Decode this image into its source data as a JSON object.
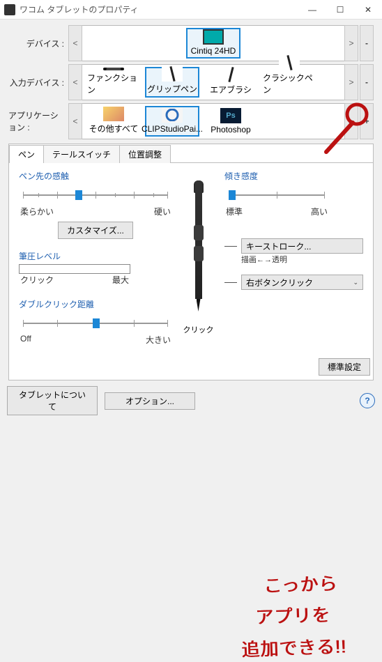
{
  "window": {
    "title": "ワコム タブレットのプロパティ"
  },
  "rows": {
    "device": {
      "label": "デバイス :",
      "items": [
        "Cintiq 24HD"
      ],
      "selected": 0
    },
    "input": {
      "label": "入力デバイス :",
      "items": [
        "ファンクション",
        "グリップペン",
        "エアブラシ",
        "クラシックペン"
      ],
      "selected": 1
    },
    "app": {
      "label": "アプリケーション :",
      "items": [
        "その他すべて",
        "CLIPStudioPai...",
        "Photoshop"
      ],
      "selected": 1,
      "plus": "+"
    }
  },
  "tabs": {
    "items": [
      "ペン",
      "テールスイッチ",
      "位置調整"
    ],
    "active": 0
  },
  "pen": {
    "tipfeel": {
      "title": "ペン先の感触",
      "left": "柔らかい",
      "right": "硬い",
      "customize": "カスタマイズ..."
    },
    "pressure": {
      "title": "筆圧レベル",
      "left": "クリック",
      "right": "最大"
    },
    "dblclick": {
      "title": "ダブルクリック距離",
      "left": "Off",
      "right": "大きい"
    },
    "tiplabel": "クリック",
    "tilt": {
      "title": "傾き感度",
      "left": "標準",
      "right": "高い"
    },
    "upper_btn": "キーストローク...",
    "upper_btn_sub": "描画←→透明",
    "lower_btn": "右ボタンクリック",
    "default_btn": "標準設定"
  },
  "footer": {
    "about": "タブレットについて",
    "options": "オプション..."
  },
  "annotation": {
    "l1": "こっから",
    "l2": "アプリを",
    "l3": "追加できる!!"
  }
}
